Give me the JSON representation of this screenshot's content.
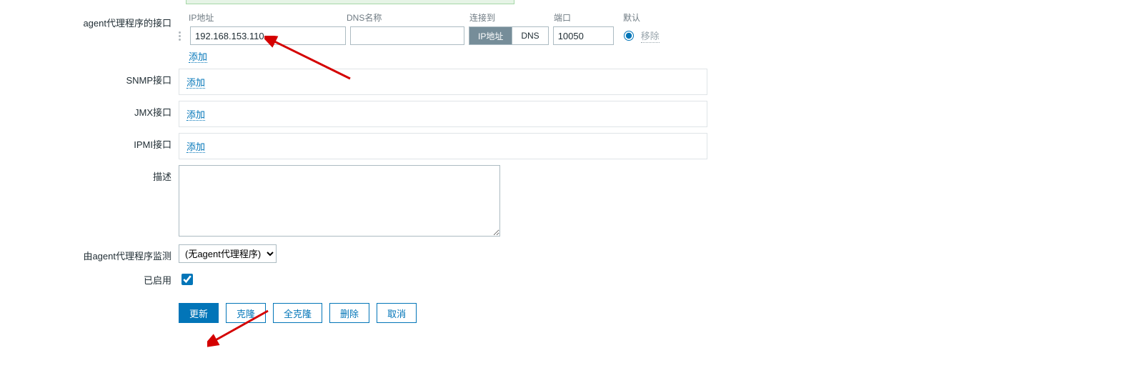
{
  "labels": {
    "agent_iface": "agent代理程序的接口",
    "snmp_iface": "SNMP接口",
    "jmx_iface": "JMX接口",
    "ipmi_iface": "IPMI接口",
    "description": "描述",
    "monitored_by": "由agent代理程序监测",
    "enabled": "已启用"
  },
  "headers": {
    "ip": "IP地址",
    "dns": "DNS名称",
    "connect_to": "连接到",
    "port": "端口",
    "default": "默认"
  },
  "agent_interface": {
    "ip_value": "192.168.153.110",
    "dns_value": "",
    "connect_ip": "IP地址",
    "connect_dns": "DNS",
    "port_value": "10050",
    "remove": "移除"
  },
  "links": {
    "add": "添加"
  },
  "proxy": {
    "selected": "(无agent代理程序)"
  },
  "buttons": {
    "update": "更新",
    "clone": "克隆",
    "full_clone": "全克隆",
    "delete": "删除",
    "cancel": "取消"
  }
}
